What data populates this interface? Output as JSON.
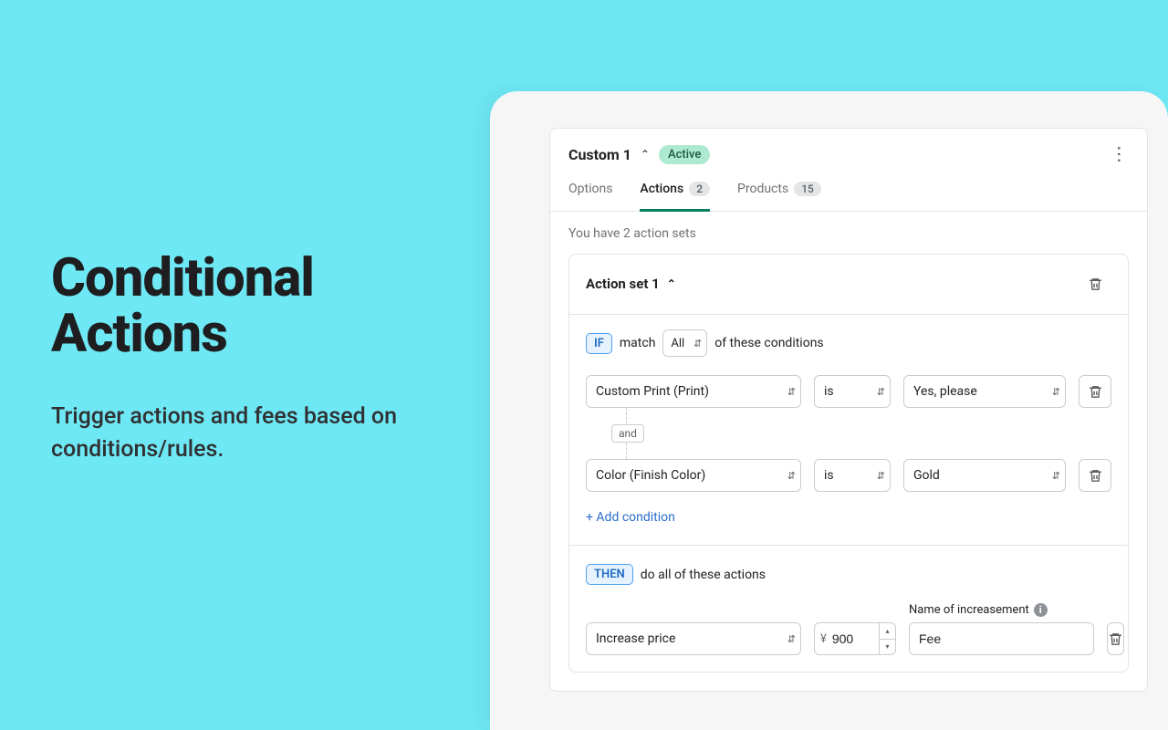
{
  "hero": {
    "title_line1": "Conditional",
    "title_line2": "Actions",
    "subtitle": "Trigger actions and fees based on conditions/rules."
  },
  "header": {
    "name": "Custom 1",
    "status": "Active"
  },
  "tabs": {
    "options": {
      "label": "Options"
    },
    "actions": {
      "label": "Actions",
      "count": "2"
    },
    "products": {
      "label": "Products",
      "count": "15"
    }
  },
  "counter": "You have 2 action sets",
  "set": {
    "title": "Action set 1",
    "if_chip": "IF",
    "match_pre": "match",
    "match_mode": "All",
    "match_post": "of these conditions",
    "conditions": [
      {
        "field": "Custom Print (Print)",
        "op": "is",
        "value": "Yes, please"
      },
      {
        "field": "Color (Finish Color)",
        "op": "is",
        "value": "Gold"
      }
    ],
    "and_label": "and",
    "add_condition": "+ Add condition",
    "then_chip": "THEN",
    "then_text": "do all of these actions",
    "inc_label": "Name of increasement",
    "action": {
      "type": "Increase price",
      "currency": "¥",
      "amount": "900",
      "fee_name": "Fee"
    }
  }
}
